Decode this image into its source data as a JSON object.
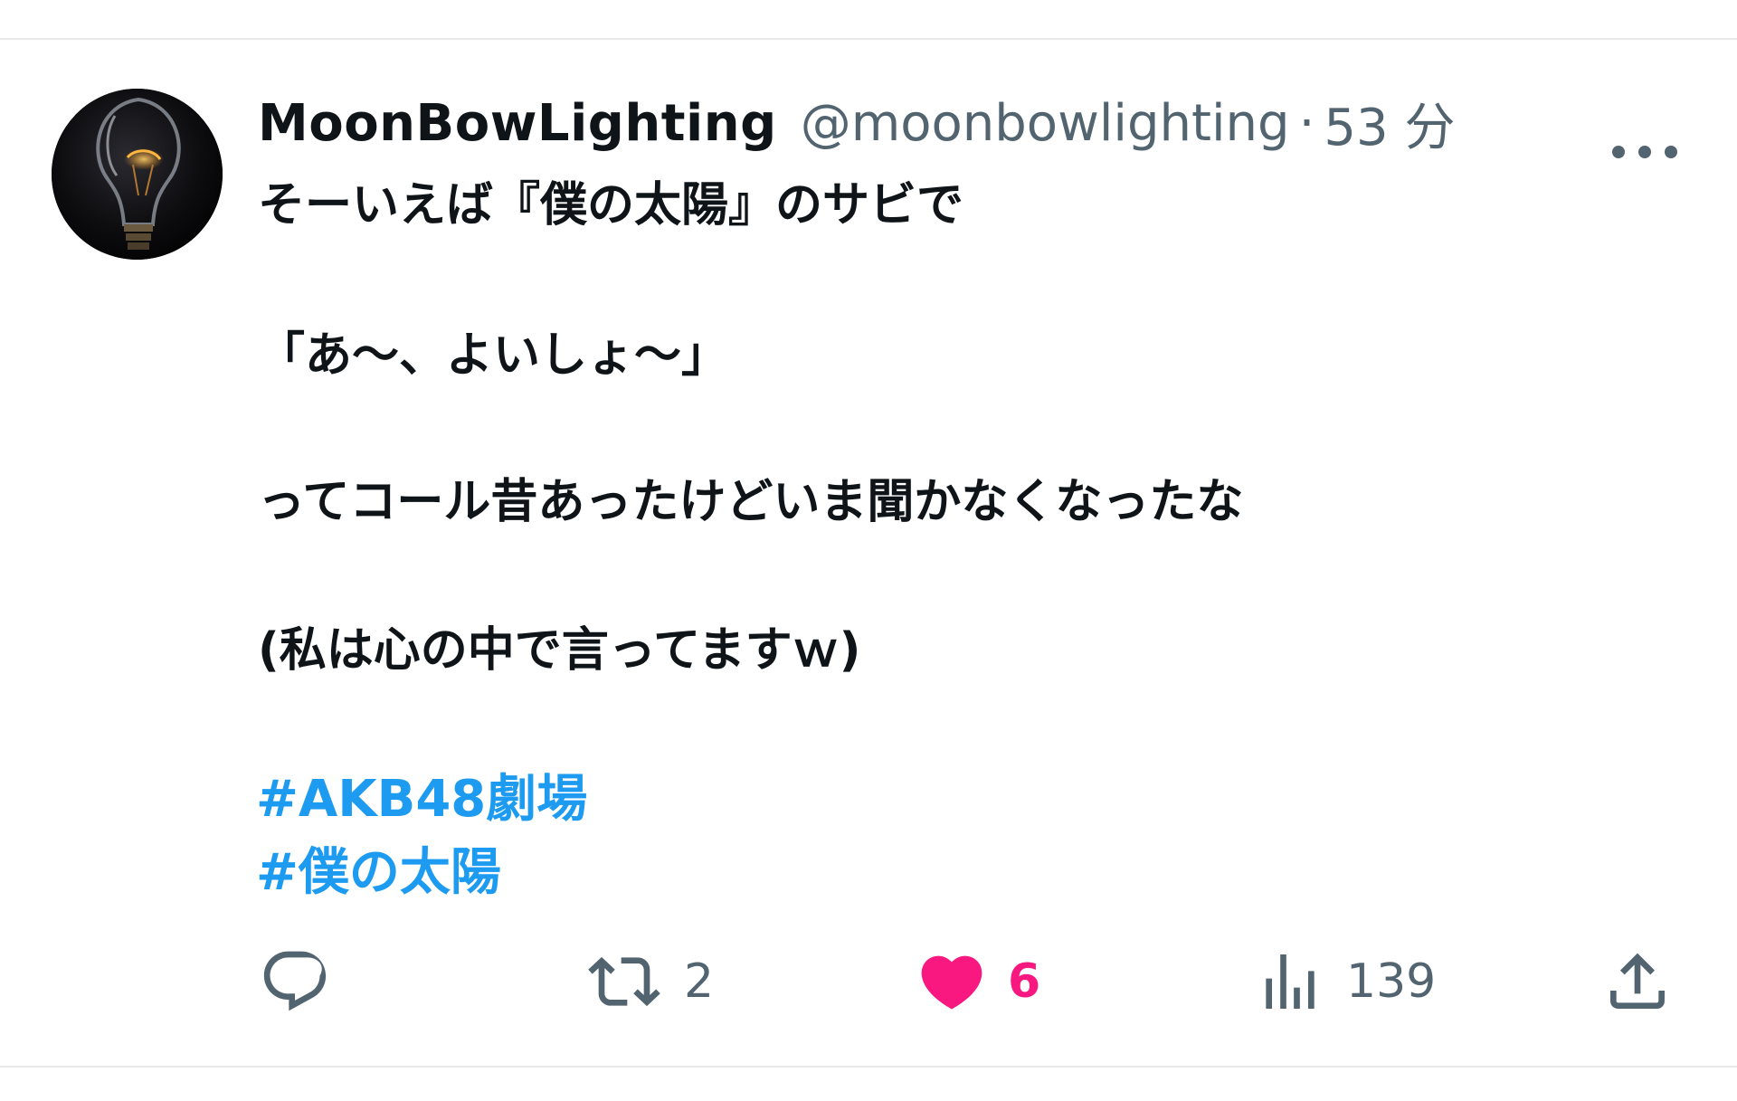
{
  "tweet": {
    "display_name": "MoonBowLighting",
    "handle": "@moonbowlighting",
    "separator": "·",
    "time": "53 分",
    "avatar_icon": "lightbulb-avatar",
    "more_icon": "more-horizontal-icon",
    "lines": [
      "そーいえば『僕の太陽』のサビで",
      "「あ〜、よいしょ〜」",
      "ってコール昔あったけどいま聞かなくなったな",
      "(私は心の中で言ってますｗ)"
    ],
    "hashtags": [
      "#AKB48劇場",
      "#僕の太陽"
    ],
    "actions": {
      "reply": {
        "icon": "reply-icon",
        "count": ""
      },
      "retweet": {
        "icon": "retweet-icon",
        "count": "2"
      },
      "like": {
        "icon": "heart-icon",
        "count": "6",
        "liked": true
      },
      "views": {
        "icon": "views-icon",
        "count": "139"
      },
      "share": {
        "icon": "share-icon"
      }
    }
  },
  "colors": {
    "text": "#0f1419",
    "secondary": "#536471",
    "link": "#1d9bf0",
    "like": "#f91880",
    "divider": "#e6e8ea"
  }
}
